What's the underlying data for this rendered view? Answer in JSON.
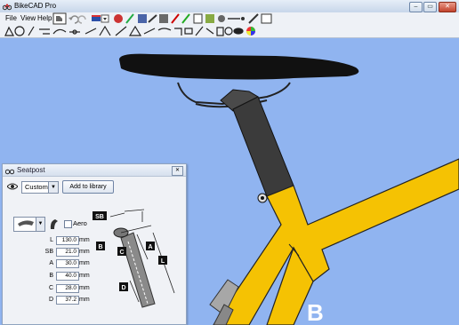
{
  "window": {
    "title": "BikeCAD Pro"
  },
  "window_controls": {
    "minimize": "–",
    "maximize": "▭",
    "close": "✕"
  },
  "menu": [
    {
      "label": "File"
    },
    {
      "label": "View"
    },
    {
      "label": "Help"
    }
  ],
  "dialog": {
    "title": "Seatpost",
    "close_label": "✕",
    "preset_value": "Custom",
    "add_to_library_label": "Add to library",
    "aero_label": "Aero",
    "params": [
      {
        "label": "L",
        "value": "130.0",
        "unit": "mm"
      },
      {
        "label": "SB",
        "value": "21.0",
        "unit": "mm"
      },
      {
        "label": "A",
        "value": "30.0",
        "unit": "mm"
      },
      {
        "label": "B",
        "value": "40.0",
        "unit": "mm"
      },
      {
        "label": "C",
        "value": "28.0",
        "unit": "mm"
      },
      {
        "label": "D",
        "value": "37.2",
        "unit": "mm"
      }
    ],
    "diagram_labels": {
      "sb": "SB",
      "b": "B",
      "c": "C",
      "a": "A",
      "l": "L",
      "d": "D"
    }
  },
  "frame_logo": "B",
  "colors": {
    "canvas": "#90b4f0",
    "frame": "#f7c304",
    "post": "#3a3a3a",
    "saddle": "#111111"
  },
  "icons": {
    "app": "bikecad-icon",
    "eye": "eye-icon"
  }
}
